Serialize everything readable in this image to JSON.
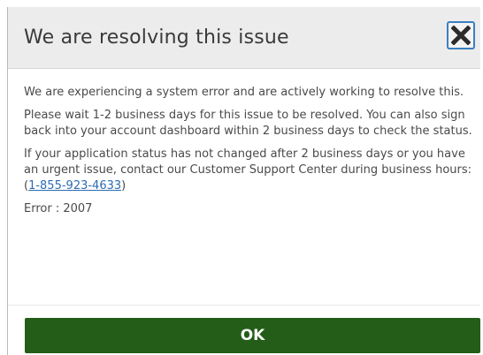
{
  "dialog": {
    "title": "We are resolving this issue",
    "close_icon": "close-x-icon",
    "paragraphs": {
      "p1": "We are experiencing a system error and are actively working to resolve this.",
      "p2": "Please wait 1-2 business days for this issue to be resolved. You can also sign back into your account dashboard within 2 business days to check the status.",
      "p3_text": "If your application status has not changed after 2 business days or you have an urgent issue, contact our Customer Support Center during business hours: (",
      "p3_link": "1-855-923-4633",
      "p3_end": ")"
    },
    "error": "Error : 2007",
    "ok_label": "OK"
  },
  "colors": {
    "header_bg": "#ececec",
    "ok_button": "#245d17",
    "close_border": "#3b7fc2",
    "link": "#2d6bb3"
  }
}
